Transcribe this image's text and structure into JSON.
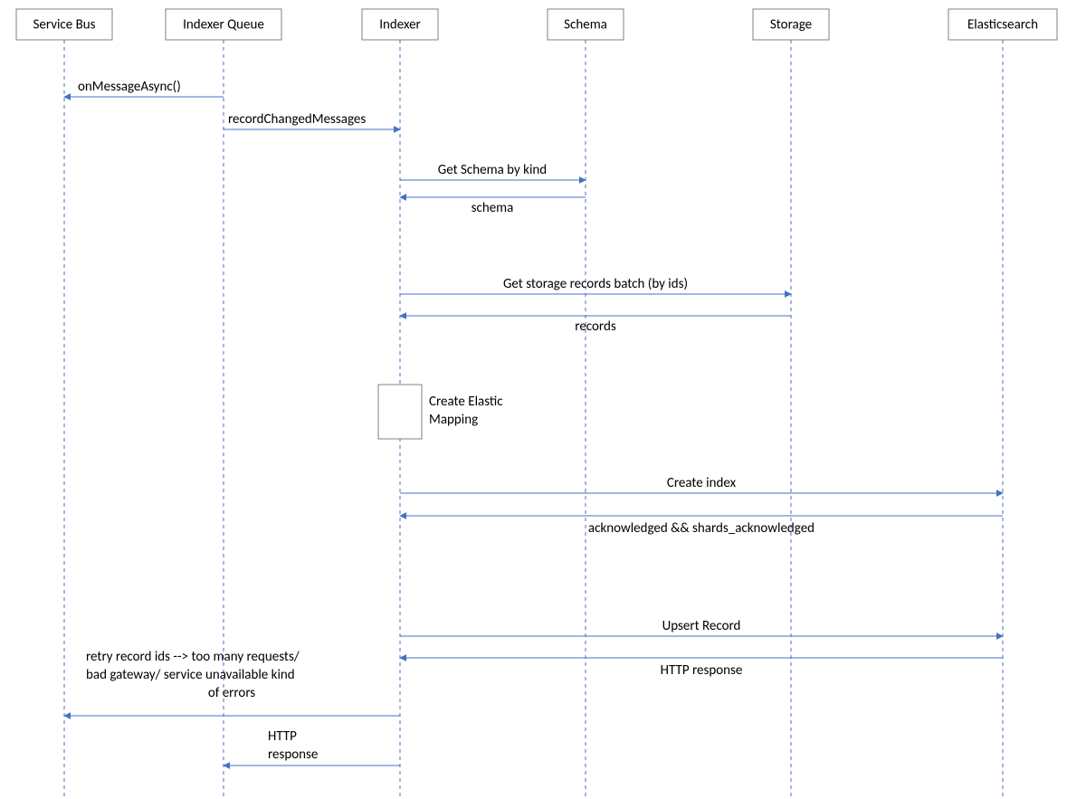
{
  "participants": {
    "service_bus": "Service Bus",
    "indexer_queue": "Indexer Queue",
    "indexer": "Indexer",
    "schema": "Schema",
    "storage": "Storage",
    "elasticsearch": "Elasticsearch"
  },
  "messages": {
    "on_message_async": "onMessageAsync()",
    "record_changed": "recordChangedMessages",
    "get_schema": "Get Schema by kind",
    "schema_resp": "schema",
    "get_storage": "Get storage records batch (by ids)",
    "records_resp": "records",
    "note_create_mapping_l1": "Create Elastic",
    "note_create_mapping_l2": "Mapping",
    "create_index": "Create index",
    "ack": "acknowledged && shards_acknowledged",
    "upsert": "Upsert Record",
    "http_resp": "HTTP response",
    "retry_l1": "retry record ids --> too many requests/",
    "retry_l2": "bad gateway/ service unavailable kind",
    "retry_l3": "of errors",
    "http_resp2_l1": "HTTP",
    "http_resp2_l2": "response"
  },
  "colors": {
    "line": "#4472C4",
    "box_stroke": "#808080"
  }
}
